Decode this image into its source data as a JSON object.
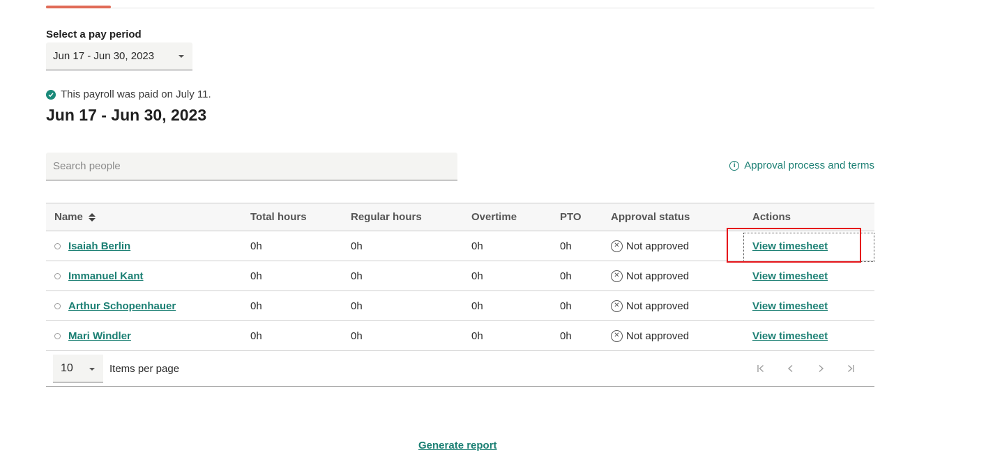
{
  "pay_period": {
    "label": "Select a pay period",
    "selected": "Jun 17 - Jun 30, 2023"
  },
  "paid_note": "This payroll was paid on July 11.",
  "heading": "Jun 17 - Jun 30, 2023",
  "search": {
    "placeholder": "Search people"
  },
  "approval_link": "Approval process and terms",
  "table": {
    "headers": {
      "name": "Name",
      "total": "Total hours",
      "regular": "Regular hours",
      "overtime": "Overtime",
      "pto": "PTO",
      "status": "Approval status",
      "actions": "Actions"
    },
    "rows": [
      {
        "name": "Isaiah Berlin",
        "total": "0h",
        "regular": "0h",
        "overtime": "0h",
        "pto": "0h",
        "status": "Not approved",
        "action": "View timesheet"
      },
      {
        "name": "Immanuel Kant",
        "total": "0h",
        "regular": "0h",
        "overtime": "0h",
        "pto": "0h",
        "status": "Not approved",
        "action": "View timesheet"
      },
      {
        "name": "Arthur Schopenhauer",
        "total": "0h",
        "regular": "0h",
        "overtime": "0h",
        "pto": "0h",
        "status": "Not approved",
        "action": "View timesheet"
      },
      {
        "name": "Mari Windler",
        "total": "0h",
        "regular": "0h",
        "overtime": "0h",
        "pto": "0h",
        "status": "Not approved",
        "action": "View timesheet"
      }
    ]
  },
  "pagination": {
    "per_page": "10",
    "per_page_label": "Items per page"
  },
  "generate_report": "Generate report",
  "colors": {
    "accent": "#1b7f73",
    "tab_indicator": "#e06b57",
    "highlight": "#e5161b"
  }
}
